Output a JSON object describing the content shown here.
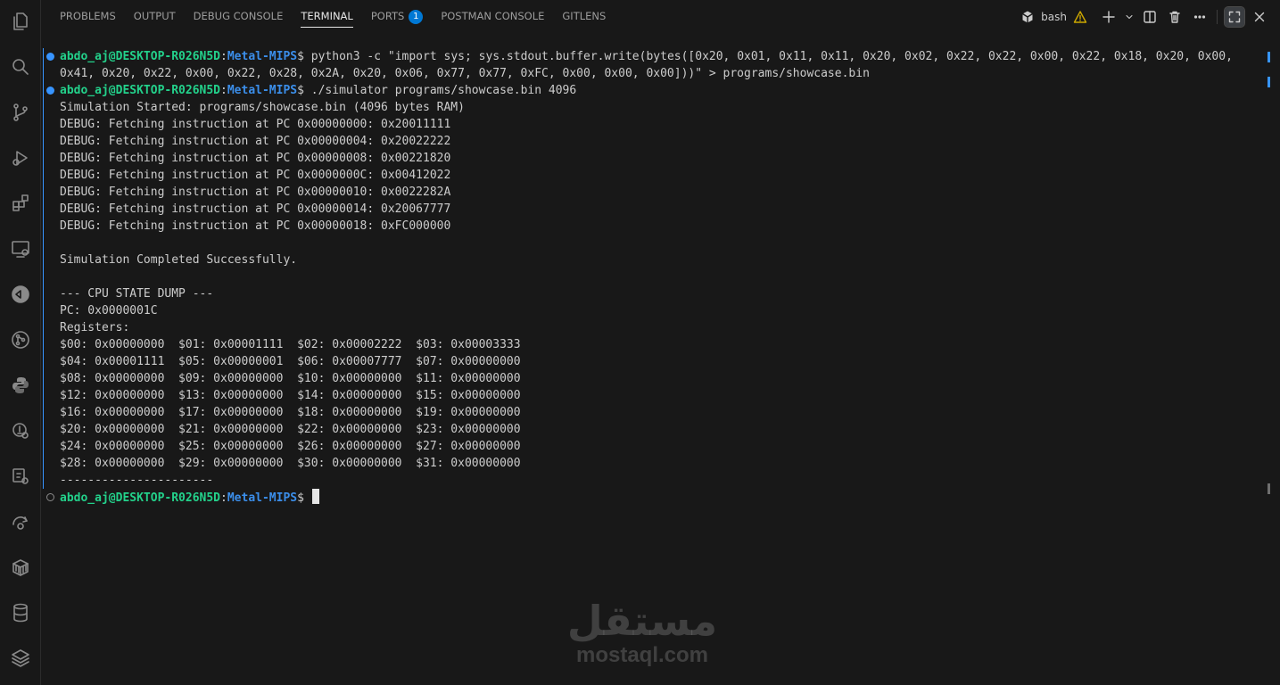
{
  "panel": {
    "tabs": [
      {
        "label": "PROBLEMS",
        "active": false
      },
      {
        "label": "OUTPUT",
        "active": false
      },
      {
        "label": "DEBUG CONSOLE",
        "active": false
      },
      {
        "label": "TERMINAL",
        "active": true
      },
      {
        "label": "PORTS",
        "active": false,
        "badge": "1"
      },
      {
        "label": "POSTMAN CONSOLE",
        "active": false
      },
      {
        "label": "GITLENS",
        "active": false
      }
    ],
    "shell_name": "bash"
  },
  "activity_bar": {
    "icons": [
      "explorer-icon",
      "search-icon",
      "source-control-icon",
      "run-debug-icon",
      "extensions-icon",
      "remote-explorer-icon",
      "edge-devtools-icon",
      "git-graph-icon",
      "python-icon",
      "container-icon",
      "test-icon",
      "thunder-client-icon",
      "package-icon",
      "database-icon",
      "layers-icon"
    ]
  },
  "terminal": {
    "prompt_user": "abdo_aj@DESKTOP-R026N5D",
    "prompt_sep": ":",
    "prompt_path": "Metal-MIPS",
    "prompt_dollar": "$",
    "cmd1_line1": " python3 -c \"import sys; sys.stdout.buffer.write(bytes([0x20, 0x01, 0x11, 0x11, 0x20, 0x02, 0x22, 0x22, 0x00, 0x22, 0x18, 0x20, 0x00,",
    "cmd1_line2": "0x41, 0x20, 0x22, 0x00, 0x22, 0x28, 0x2A, 0x20, 0x06, 0x77, 0x77, 0xFC, 0x00, 0x00, 0x00]))\" > programs/showcase.bin",
    "cmd2": " ./simulator programs/showcase.bin 4096",
    "output": [
      "Simulation Started: programs/showcase.bin (4096 bytes RAM)",
      "DEBUG: Fetching instruction at PC 0x00000000: 0x20011111",
      "DEBUG: Fetching instruction at PC 0x00000004: 0x20022222",
      "DEBUG: Fetching instruction at PC 0x00000008: 0x00221820",
      "DEBUG: Fetching instruction at PC 0x0000000C: 0x00412022",
      "DEBUG: Fetching instruction at PC 0x00000010: 0x0022282A",
      "DEBUG: Fetching instruction at PC 0x00000014: 0x20067777",
      "DEBUG: Fetching instruction at PC 0x00000018: 0xFC000000",
      "",
      "Simulation Completed Successfully.",
      "",
      "--- CPU STATE DUMP ---",
      "PC: 0x0000001C",
      "Registers:",
      "$00: 0x00000000  $01: 0x00001111  $02: 0x00002222  $03: 0x00003333",
      "$04: 0x00001111  $05: 0x00000001  $06: 0x00007777  $07: 0x00000000",
      "$08: 0x00000000  $09: 0x00000000  $10: 0x00000000  $11: 0x00000000",
      "$12: 0x00000000  $13: 0x00000000  $14: 0x00000000  $15: 0x00000000",
      "$16: 0x00000000  $17: 0x00000000  $18: 0x00000000  $19: 0x00000000",
      "$20: 0x00000000  $21: 0x00000000  $22: 0x00000000  $23: 0x00000000",
      "$24: 0x00000000  $25: 0x00000000  $26: 0x00000000  $27: 0x00000000",
      "$28: 0x00000000  $29: 0x00000000  $30: 0x00000000  $31: 0x00000000",
      "----------------------"
    ]
  },
  "watermark": {
    "arabic": "مستقل",
    "latin": "mostaql.com"
  },
  "colors": {
    "background": "#181818",
    "prompt_user": "#23d18b",
    "prompt_path": "#3b8eea",
    "accent": "#0078d4",
    "decoration": "#3794ff"
  }
}
